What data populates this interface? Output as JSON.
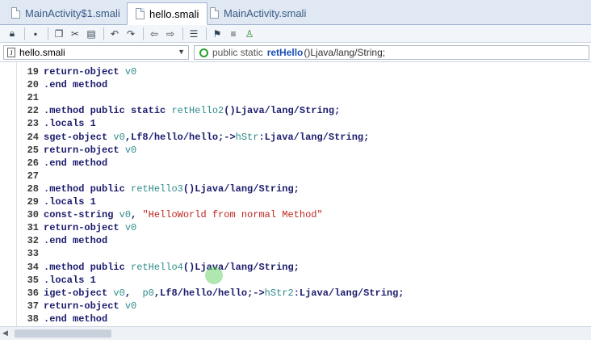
{
  "tabs": [
    {
      "label": "MainActivity$1.smali",
      "active": false
    },
    {
      "label": "hello.smali",
      "active": true
    },
    {
      "label": "MainActivity.smali",
      "active": false
    }
  ],
  "nav": {
    "file": "hello.smali",
    "method_prefix": "public static",
    "method_name": "retHello",
    "method_suffix": "()Ljava/lang/String;"
  },
  "lines": [
    {
      "n": "19",
      "parts": [
        [
          "k",
          "return-object "
        ],
        [
          "r",
          "v0"
        ]
      ]
    },
    {
      "n": "20",
      "parts": [
        [
          "k",
          ".end method"
        ]
      ]
    },
    {
      "n": "21",
      "parts": []
    },
    {
      "n": "22",
      "parts": [
        [
          "k",
          ".method public static "
        ],
        [
          "m",
          "retHello2"
        ],
        [
          "k",
          "()Ljava/lang/String;"
        ]
      ]
    },
    {
      "n": "23",
      "parts": [
        [
          "k",
          ".locals 1"
        ]
      ]
    },
    {
      "n": "24",
      "parts": [
        [
          "k",
          "sget-object "
        ],
        [
          "r",
          "v0"
        ],
        [
          "k",
          ",Lf8/hello/hello;->"
        ],
        [
          "m",
          "hStr"
        ],
        [
          "k",
          ":Ljava/lang/String;"
        ]
      ]
    },
    {
      "n": "25",
      "parts": [
        [
          "k",
          "return-object "
        ],
        [
          "r",
          "v0"
        ]
      ]
    },
    {
      "n": "26",
      "parts": [
        [
          "k",
          ".end method"
        ]
      ]
    },
    {
      "n": "27",
      "parts": []
    },
    {
      "n": "28",
      "parts": [
        [
          "k",
          ".method public "
        ],
        [
          "m",
          "retHello3"
        ],
        [
          "k",
          "()Ljava/lang/String;"
        ]
      ]
    },
    {
      "n": "29",
      "parts": [
        [
          "k",
          ".locals 1"
        ]
      ]
    },
    {
      "n": "30",
      "parts": [
        [
          "k",
          "const-string "
        ],
        [
          "r",
          "v0"
        ],
        [
          "k",
          ", "
        ],
        [
          "s",
          "\"HelloWorld from normal Method\""
        ]
      ]
    },
    {
      "n": "31",
      "parts": [
        [
          "k",
          "return-object "
        ],
        [
          "r",
          "v0"
        ]
      ]
    },
    {
      "n": "32",
      "parts": [
        [
          "k",
          ".end method"
        ]
      ]
    },
    {
      "n": "33",
      "parts": []
    },
    {
      "n": "34",
      "parts": [
        [
          "k",
          ".method public "
        ],
        [
          "m",
          "retHello4"
        ],
        [
          "k",
          "()Ljava/lang/String;"
        ]
      ]
    },
    {
      "n": "35",
      "parts": [
        [
          "k",
          ".locals 1"
        ]
      ]
    },
    {
      "n": "36",
      "parts": [
        [
          "k",
          "iget-object "
        ],
        [
          "r",
          "v0"
        ],
        [
          "k",
          ",  "
        ],
        [
          "r",
          "p0"
        ],
        [
          "k",
          ",Lf8/hello/hello;->"
        ],
        [
          "m",
          "hStr2"
        ],
        [
          "k",
          ":Ljava/lang/String;"
        ]
      ]
    },
    {
      "n": "37",
      "parts": [
        [
          "k",
          "return-object "
        ],
        [
          "r",
          "v0"
        ]
      ]
    },
    {
      "n": "38",
      "parts": [
        [
          "k",
          ".end method"
        ]
      ]
    }
  ]
}
